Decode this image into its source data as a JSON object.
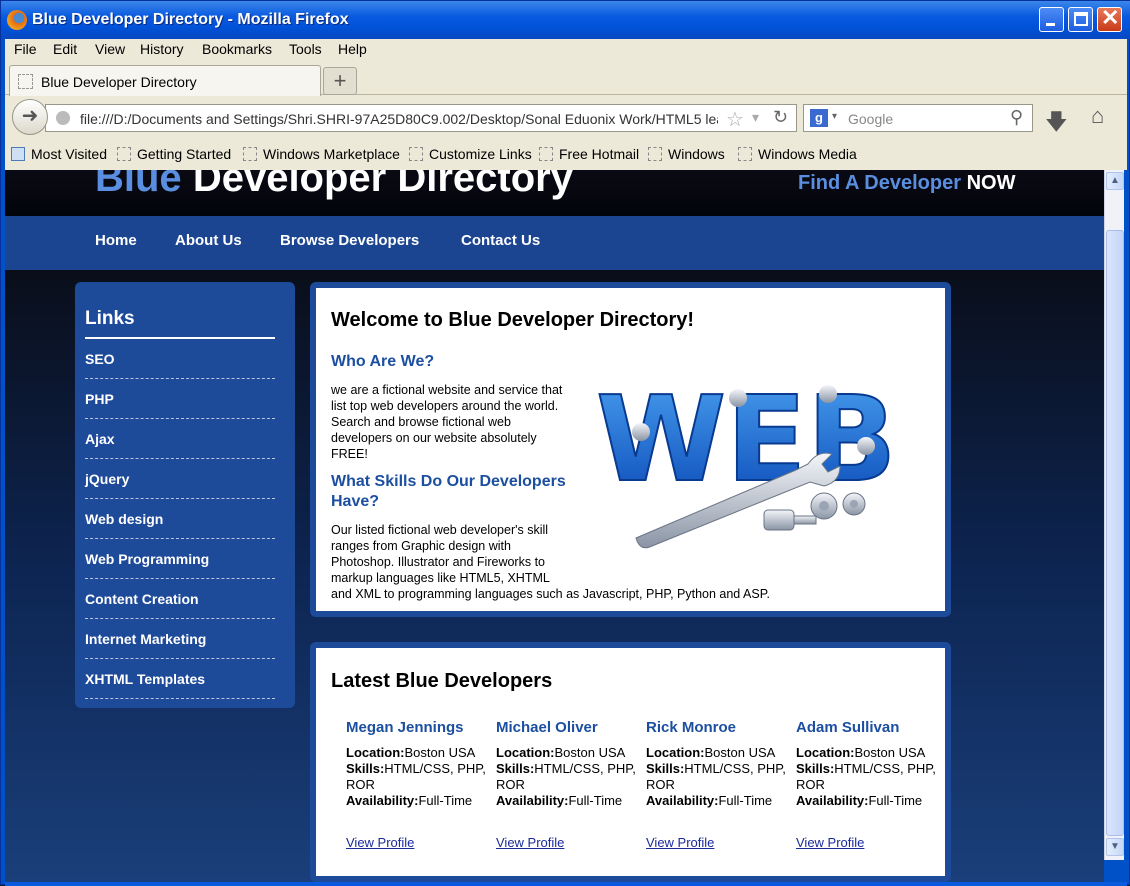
{
  "window": {
    "title": "Blue Developer Directory - Mozilla Firefox"
  },
  "menubar": {
    "items": [
      "File",
      "Edit",
      "View",
      "History",
      "Bookmarks",
      "Tools",
      "Help"
    ]
  },
  "tabs": {
    "active_tab": "Blue Developer Directory",
    "new_tab_label": "+"
  },
  "navbar": {
    "url": "file:///D:/Documents and Settings/Shri.SHRI-97A25D80C9.002/Desktop/Sonal Eduonix Work/HTML5 lea",
    "search_placeholder": "Google",
    "search_engine_icon": "google-icon"
  },
  "bookmarks": {
    "items": [
      "Most Visited",
      "Getting Started",
      "Windows Marketplace",
      "Customize Links",
      "Free Hotmail",
      "Windows",
      "Windows Media"
    ]
  },
  "site": {
    "logo_blue": "Blue",
    "logo_white": "Developer Directory",
    "find_blue": "Find A Developer",
    "find_white": "NOW",
    "nav": [
      "Home",
      "About Us",
      "Browse Developers",
      "Contact Us"
    ],
    "sidebar": {
      "title": "Links",
      "items": [
        "SEO",
        "PHP",
        "Ajax",
        "jQuery",
        "Web design",
        "Web Programming",
        "Content Creation",
        "Internet Marketing",
        "XHTML Templates"
      ]
    },
    "welcome": {
      "title": "Welcome to Blue Developer Directory!",
      "who_heading": "Who Are We?",
      "who_text": "we are a fictional website and service that list top web developers around the world. Search and browse fictional web developers on our website absolutely FREE!",
      "skills_heading": "What Skills Do Our Developers Have?",
      "skills_text_1": "Our listed fictional web developer's skill ranges from Graphic design with Photoshop. Illustrator and Fireworks to markup languages like HTML5, XHTML",
      "skills_text_2": "and XML to programming languages such as Javascript, PHP, Python and ASP.",
      "image_text": "WEB"
    },
    "latest": {
      "title": "Latest Blue Developers",
      "location_label": "Location:",
      "skills_label": "Skills:",
      "availability_label": "Availability:",
      "developers": [
        {
          "name": "Megan Jennings",
          "location": "Boston USA",
          "skills": "HTML/CSS, PHP, ROR",
          "availability": "Full-Time",
          "link": "View Profile"
        },
        {
          "name": "Michael Oliver",
          "location": "Boston USA",
          "skills": "HTML/CSS, PHP, ROR",
          "availability": "Full-Time",
          "link": "View Profile"
        },
        {
          "name": "Rick Monroe",
          "location": "Boston USA",
          "skills": "HTML/CSS, PHP, ROR",
          "availability": "Full-Time",
          "link": "View Profile"
        },
        {
          "name": "Adam Sullivan",
          "location": "Boston USA",
          "skills": "HTML/CSS, PHP, ROR",
          "availability": "Full-Time",
          "link": "View Profile"
        }
      ]
    }
  },
  "colors": {
    "accent_blue": "#1c4591",
    "heading_blue": "#1c4fa0",
    "logo_blue": "#5a8ee0"
  }
}
